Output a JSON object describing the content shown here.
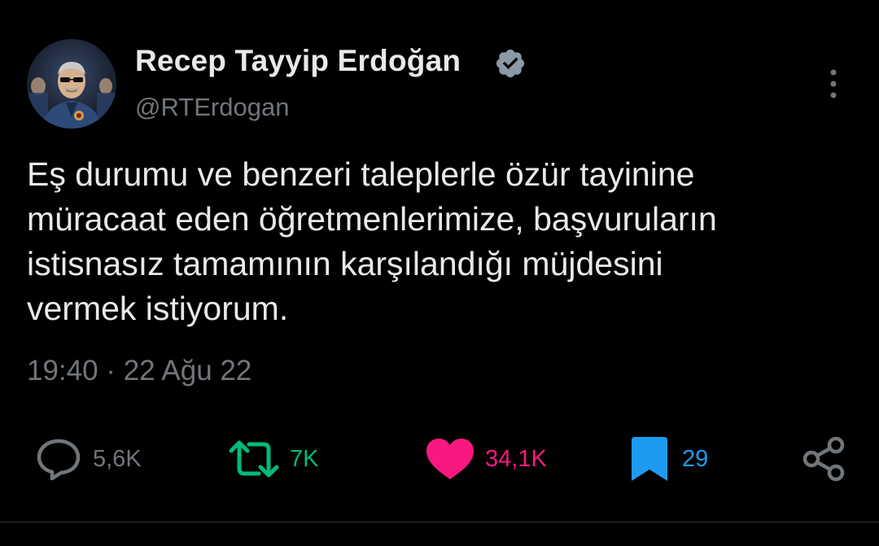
{
  "author": {
    "name": "Recep Tayyip Erdoğan",
    "handle": "@RTErdogan",
    "verified": true
  },
  "tweet": {
    "lines": [
      "Eş durumu ve benzeri taleplerle özür tayinine",
      "müracaat eden öğretmenlerimize, başvuruların",
      "istisnasız tamamının karşılandığı müjdesini",
      "vermek istiyorum."
    ],
    "timestamp": "19:40 · 22 Ağu 22"
  },
  "actions": {
    "reply": {
      "icon": "reply-icon",
      "count": "5,6K"
    },
    "retweet": {
      "icon": "retweet-icon",
      "count": "7K"
    },
    "like": {
      "icon": "heart-icon",
      "count": "34,1K",
      "active": true
    },
    "bookmark": {
      "icon": "bookmark-icon",
      "count": "29",
      "active": true
    },
    "share": {
      "icon": "share-icon"
    }
  },
  "colors": {
    "background": "#000000",
    "text": "#e7e9ea",
    "secondary": "#71767b",
    "retweet": "#00ba7c",
    "like": "#f91880",
    "bookmark": "#1d9bf0"
  }
}
